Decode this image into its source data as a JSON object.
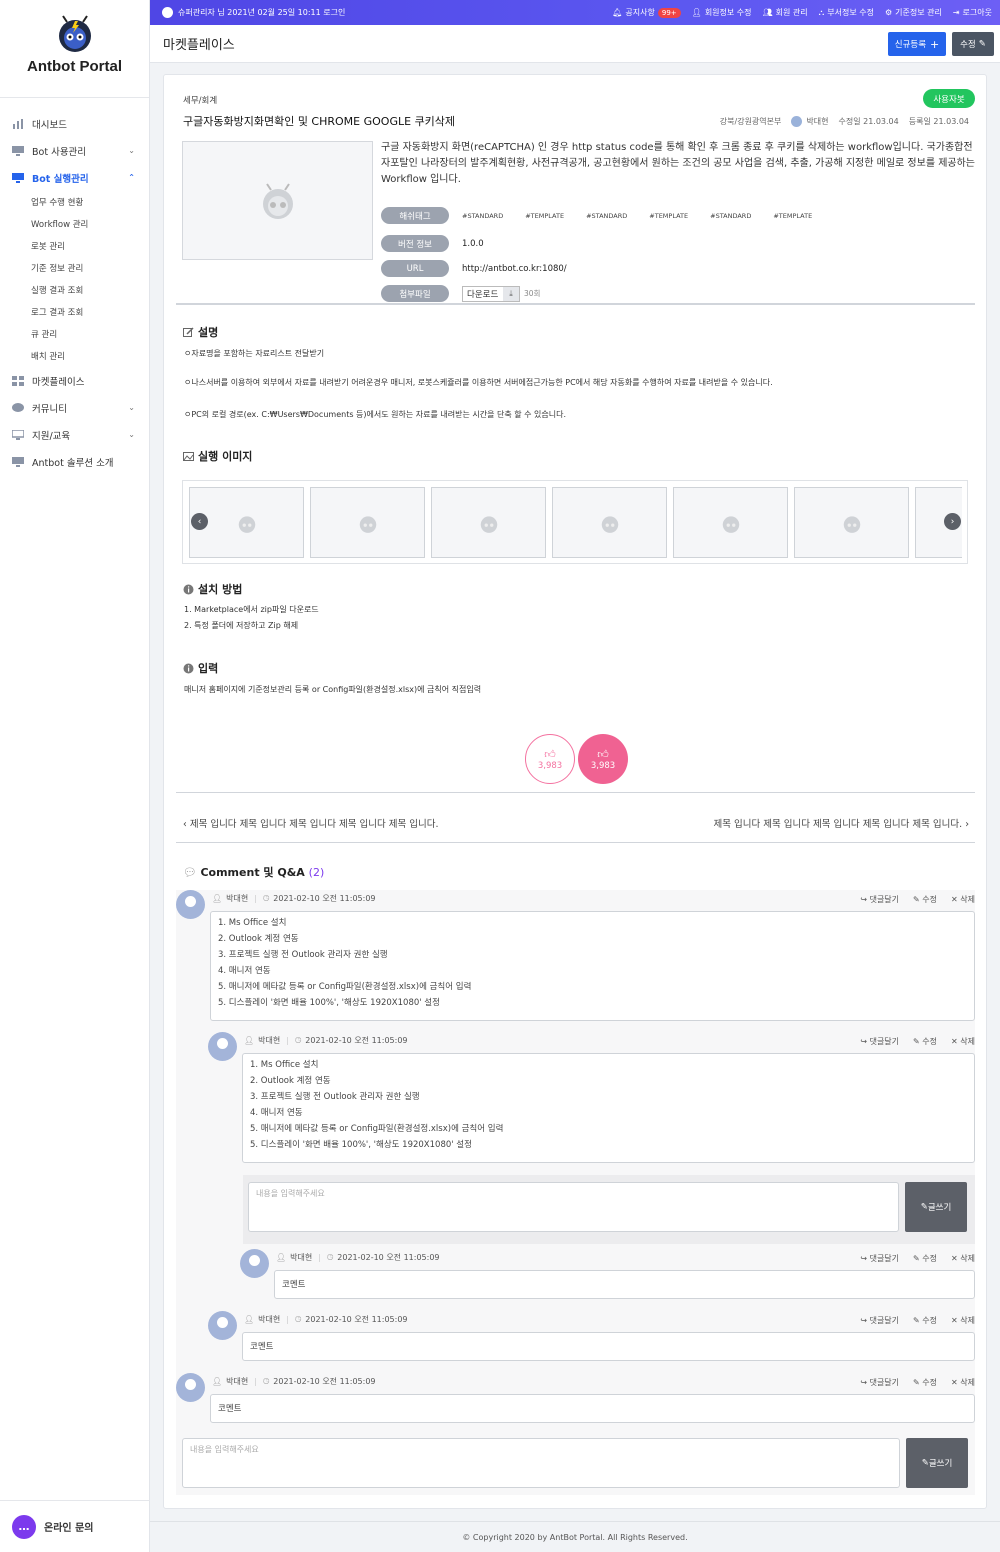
{
  "app": {
    "title": "Antbot Portal"
  },
  "sidebar": {
    "items": [
      {
        "label": "대시보드"
      },
      {
        "label": "Bot 사용관리"
      },
      {
        "label": "Bot 실행관리"
      },
      {
        "label": "마켓플레이스"
      },
      {
        "label": "커뮤니티"
      },
      {
        "label": "지원/교육"
      },
      {
        "label": "Antbot 솔루션 소개"
      }
    ],
    "subitems": [
      "업무 수행 현황",
      "Workflow 관리",
      "로봇 관리",
      "기준 정보 관리",
      "실행 결과 조회",
      "로그 결과 조회",
      "큐 관리",
      "배치 관리"
    ],
    "online": "온라인 문의"
  },
  "topbar": {
    "login_info": "슈퍼관리자 님 2021년 02월 25일 10:11 로그인",
    "notice": "공지사항",
    "notice_count": "99+",
    "member_edit": "회원정보 수정",
    "member_mgmt": "회원 관리",
    "dept_edit": "부서정보 수정",
    "base_info": "기준정보 관리",
    "logout": "로그아웃"
  },
  "header": {
    "title": "마켓플레이스",
    "new_btn": "신규등록",
    "edit_btn": "수정"
  },
  "product": {
    "category": "세무/회계",
    "status": "사용자봇",
    "title": "구글자동화방지화면확인 및 CHROME GOOGLE 쿠키삭제",
    "dept": "강북/강원광역본부",
    "author": "박대현",
    "modified_label": "수정일",
    "modified": "21.03.04",
    "registered_label": "등록일",
    "registered": "21.03.04",
    "description": "구글 자동화방지 화면(reCAPTCHA) 인 경우 http status code를 통해 확인 후 크롬 종료 후 쿠키를 삭제하는 workflow입니다. 국가종합전자포탈인 나라장터의 발주계획현황, 사전규격공개, 공고현황에서 원하는 조건의 공모 사업을 검색, 추출, 가공해 지정한 메일로 정보를 제공하는 Workflow 입니다.",
    "hashtag_label": "해쉬태그",
    "tags": [
      "#STANDARD",
      "#TEMPLATE",
      "#STANDARD",
      "#TEMPLATE",
      "#STANDARD",
      "#TEMPLATE"
    ],
    "version_label": "버전 정보",
    "version": "1.0.0",
    "url_label": "URL",
    "url": "http://antbot.co.kr:1080/",
    "file_label": "첨부파일",
    "download": "다운로드",
    "download_count": "30회"
  },
  "sections": {
    "desc_title": "설명",
    "desc_lines": [
      "ㅇ자료명을 포함하는 자료리스트 전달받기",
      "ㅇ나스서버를 이용하여 외부에서 자료를 내려받기 어려운경우 매니저, 로봇스케쥴러를 이용하면 서버에접근가능한 PC에서 해당 자동화를 수행하여 자료를 내려받을 수 있습니다.",
      "ㅇPC의 로컬 경로(ex. C:₩Users₩Documents 등)에서도 원하는 자료를 내려받는 시간을 단축 할 수 있습니다."
    ],
    "images_title": "실행 이미지",
    "install_title": "설치 방법",
    "install_lines": [
      "1. Marketplace에서 zip파일 다운로드",
      "2. 특정 폴더에 저장하고 Zip 해제"
    ],
    "input_title": "입력",
    "input_text": "매니저 홈페이지에 기준정보관리 등록 or Config파일(환경설정.xlsx)에 금칙어 직접입력"
  },
  "likes": {
    "a": "3,983",
    "b": "3,983"
  },
  "nav": {
    "prev": "제목 입니다 제목 입니다 제목 입니다 제목 입니다 제목 입니다.",
    "next": "제목 입니다 제목 입니다 제목 입니다 제목 입니다 제목 입니다."
  },
  "comments": {
    "title": "Comment 및 Q&A",
    "count": "(2)",
    "author": "박대현",
    "date": "2021-02-10 오전 11:05:09",
    "reply": "댓글달기",
    "edit": "수정",
    "del": "삭제",
    "list_lines": [
      "1. Ms Office 설치",
      "2. Outlook 계정 연동",
      "3. 프로젝트 실행 전 Outlook 관리자 권한 실행",
      "4. 매니저 연동",
      "5. 매니저에 메타값 등록 or Config파일(환경설정.xlsx)에 금칙어 입력",
      "5. 디스플레이 '화면 배율 100%', '해상도 1920X1080' 설정"
    ],
    "short": "코멘트",
    "placeholder": "내용을 입력해주세요",
    "write": "글쓰기"
  },
  "footer": {
    "copyright": "© Copyright 2020 by AntBot Portal. All Rights Reserved."
  }
}
